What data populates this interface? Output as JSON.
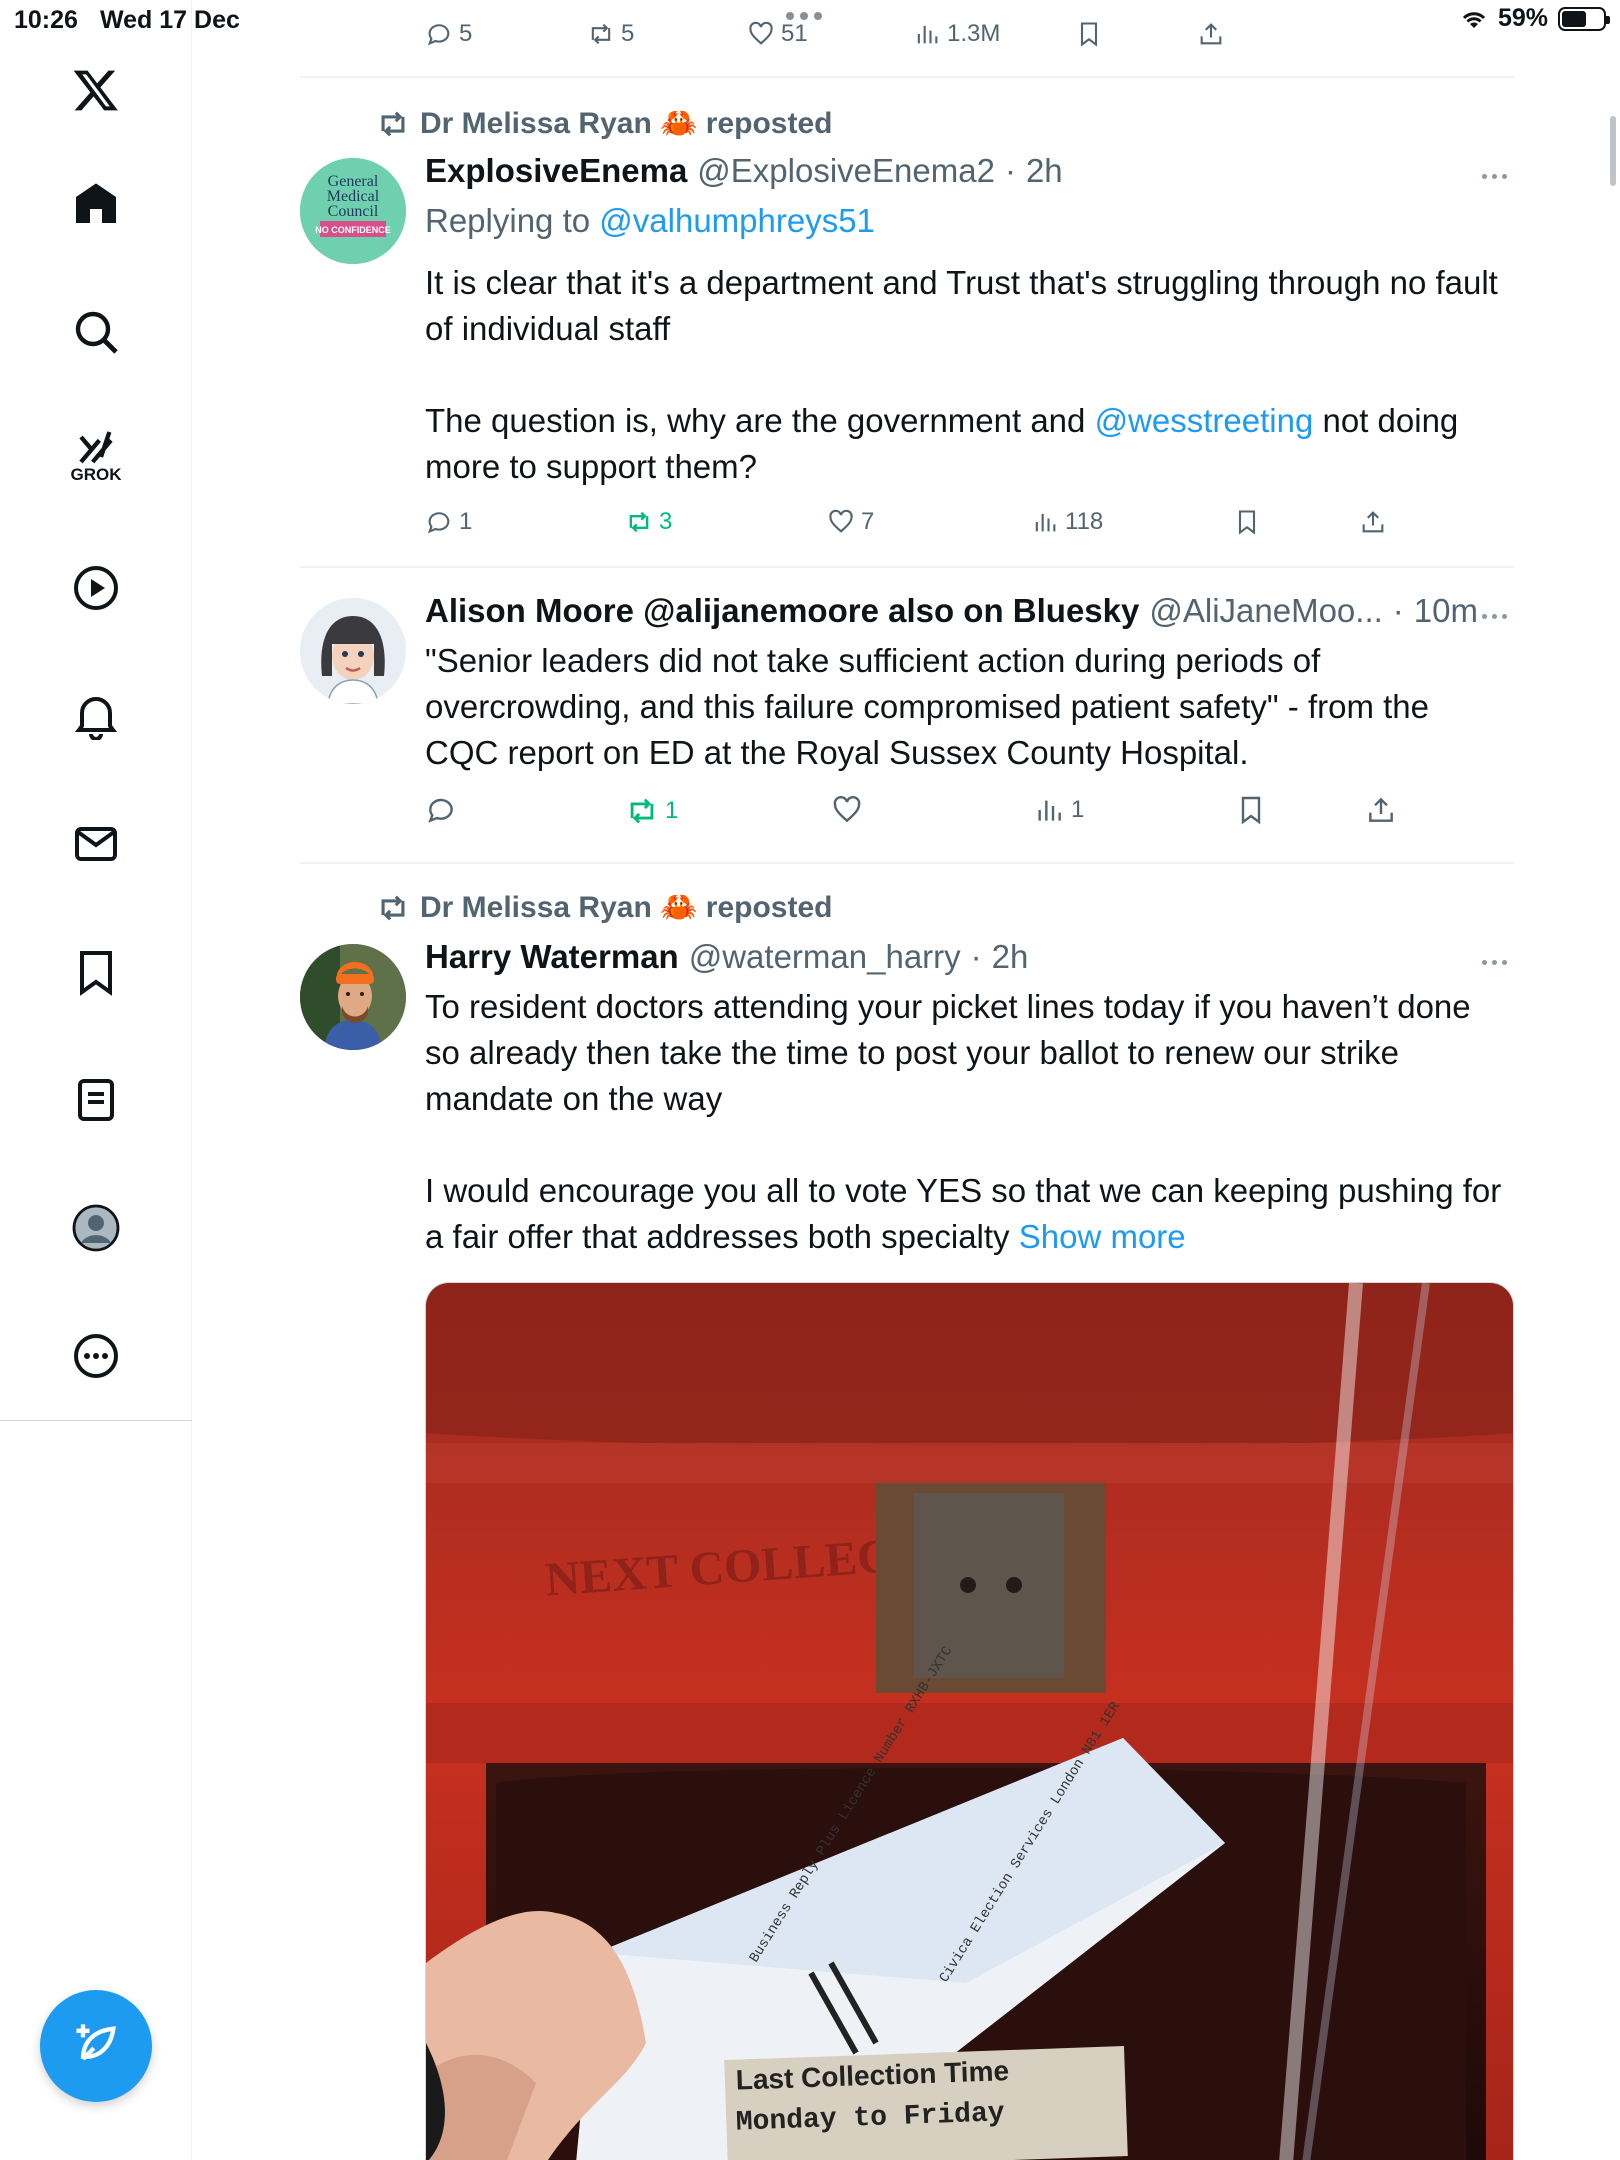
{
  "status_bar": {
    "time": "10:26",
    "date": "Wed 17 Dec",
    "battery": "59%"
  },
  "top_actions": {
    "replies": "5",
    "reposts": "5",
    "likes": "51",
    "views": "1.3M"
  },
  "posts": [
    {
      "repost_by": "Dr Melissa Ryan 🦀 reposted",
      "author_name": "ExplosiveEnema",
      "author_handle": "@ExplosiveEnema2",
      "time": "2h",
      "replying_prefix": "Replying to",
      "replying_handle": "@valhumphreys51",
      "avatar_text": [
        "General",
        "Medical",
        "Council",
        "NO CONFIDENCE"
      ],
      "text_1": "It is clear that it's a department and Trust that's struggling through no fault of individual staff",
      "text_2a": "The question is, why are the government and",
      "text_2_mention": "@wesstreeting",
      "text_2b": "not doing more to support them?",
      "replies": "1",
      "reposts": "3",
      "likes": "7",
      "views": "118"
    },
    {
      "author_name": "Alison Moore @alijanemoore also on Bluesky",
      "author_handle": "@AliJaneMoo...",
      "time": "10m",
      "text_1": "\"Senior leaders did not take sufficient action during periods of overcrowding, and this failure compromised patient safety\" - from the CQC report on ED at the Royal Sussex County Hospital.",
      "replies": "",
      "reposts": "1",
      "likes": "",
      "views": "1"
    },
    {
      "repost_by": "Dr Melissa Ryan 🦀 reposted",
      "author_name": "Harry Waterman",
      "author_handle": "@waterman_harry",
      "time": "2h",
      "text_1": "To resident doctors attending your picket lines today if you haven’t done so already then take the time to post your ballot to renew our strike mandate on the way",
      "text_2": "I would encourage you all to vote YES so that we can keeping pushing for a fair offer that addresses both specialty",
      "show_more": "Show more",
      "image": {
        "box_text": "NEXT COLLECTION",
        "envelope_left": "Business Reply Plus Licence Number RXHB-JXTC",
        "envelope_right": "Civica Election Services London N81 1ER",
        "plate_line1": "Last Collection Time",
        "plate_line2": "Monday to Friday"
      }
    }
  ],
  "sidebar": {
    "grok_label": "GROK"
  },
  "colors": {
    "accent": "#1d9bf0",
    "repost_green": "#00ba7c",
    "muted": "#536471",
    "postbox_red": "#c62b1c"
  }
}
